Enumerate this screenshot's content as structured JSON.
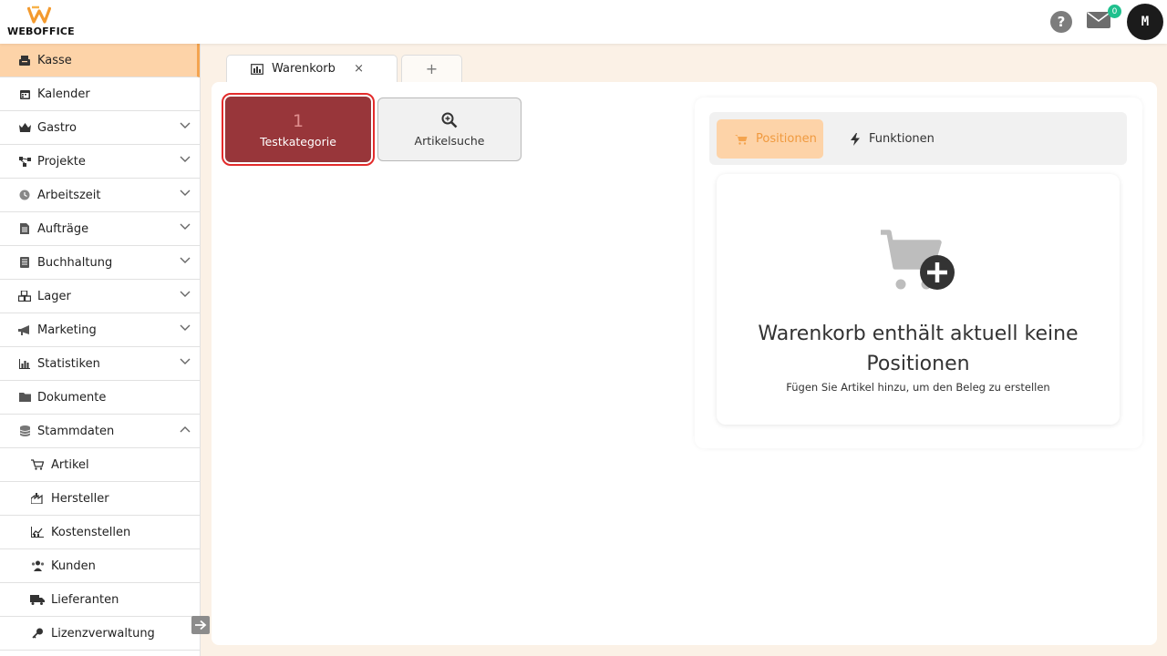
{
  "app": {
    "logo_text": "WEBOFFICE"
  },
  "header": {
    "help_symbol": "?",
    "mail_count": "0",
    "avatar_initial": "M"
  },
  "sidebar": {
    "items": [
      {
        "label": "Kasse",
        "icon": "register-icon",
        "active": true,
        "chevron": ""
      },
      {
        "label": "Kalender",
        "icon": "calendar-icon",
        "chevron": ""
      },
      {
        "label": "Gastro",
        "icon": "crown-icon",
        "chevron": "down"
      },
      {
        "label": "Projekte",
        "icon": "project-icon",
        "chevron": "down"
      },
      {
        "label": "Arbeitszeit",
        "icon": "clock-icon",
        "chevron": "down"
      },
      {
        "label": "Aufträge",
        "icon": "document-icon",
        "chevron": "down"
      },
      {
        "label": "Buchhaltung",
        "icon": "ledger-icon",
        "chevron": "down"
      },
      {
        "label": "Lager",
        "icon": "boxes-icon",
        "chevron": "down"
      },
      {
        "label": "Marketing",
        "icon": "megaphone-icon",
        "chevron": "down"
      },
      {
        "label": "Statistiken",
        "icon": "chart-icon",
        "chevron": "down"
      },
      {
        "label": "Dokumente",
        "icon": "folder-icon",
        "chevron": ""
      },
      {
        "label": "Stammdaten",
        "icon": "database-icon",
        "chevron": "up"
      }
    ],
    "sub_items": [
      {
        "label": "Artikel",
        "icon": "cart-icon"
      },
      {
        "label": "Hersteller",
        "icon": "factory-icon"
      },
      {
        "label": "Kostenstellen",
        "icon": "cost-chart-icon"
      },
      {
        "label": "Kunden",
        "icon": "users-icon"
      },
      {
        "label": "Lieferanten",
        "icon": "truck-icon"
      },
      {
        "label": "Lizenzverwaltung",
        "icon": "key-icon"
      }
    ]
  },
  "tabs": {
    "main_label": "Warenkorb",
    "close_symbol": "×",
    "add_symbol": "+"
  },
  "categories": {
    "count": "1",
    "label": "Testkategorie",
    "search_label": "Artikelsuche"
  },
  "cart": {
    "tab_positions": "Positionen",
    "tab_functions": "Funktionen",
    "empty_title": "Warenkorb enthält aktuell keine Positionen",
    "empty_subtitle": "Fügen Sie Artikel hinzu, um den Beleg zu erstellen"
  },
  "colors": {
    "accent": "#f4a44f",
    "active_bg": "#fdd3a8",
    "category": "#98363a",
    "badge": "#1fc08d"
  }
}
